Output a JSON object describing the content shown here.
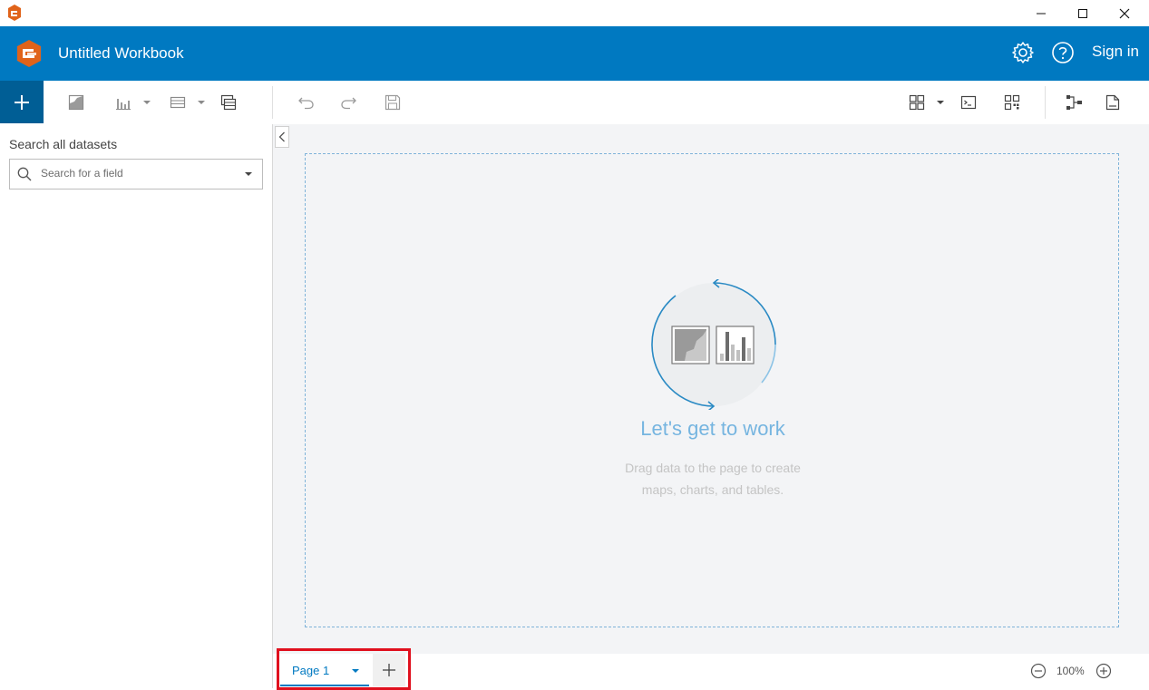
{
  "window": {
    "minimize_icon": "minimize-icon",
    "maximize_icon": "maximize-icon",
    "close_icon": "close-icon"
  },
  "header": {
    "title": "Untitled Workbook",
    "sign_in": "Sign in",
    "settings_icon": "gear-icon",
    "help_icon": "help-icon",
    "background": "#0079c1"
  },
  "toolbar": {
    "tools": [
      "add-icon",
      "map-icon",
      "chart-icon",
      "table-icon",
      "summary-table-icon",
      "undo-icon",
      "redo-icon",
      "save-icon",
      "layout-icon",
      "console-icon",
      "qr-icon",
      "model-icon",
      "page-settings-icon"
    ]
  },
  "sidebar": {
    "label": "Search all datasets",
    "search_placeholder": "Search for a field"
  },
  "canvas": {
    "title": "Let's get to work",
    "line1": "Drag data to the page to create",
    "line2": "maps, charts, and tables."
  },
  "pages": {
    "tabs": [
      {
        "label": "Page 1"
      }
    ],
    "add_icon": "plus-icon"
  },
  "zoom": {
    "value": "100%"
  }
}
